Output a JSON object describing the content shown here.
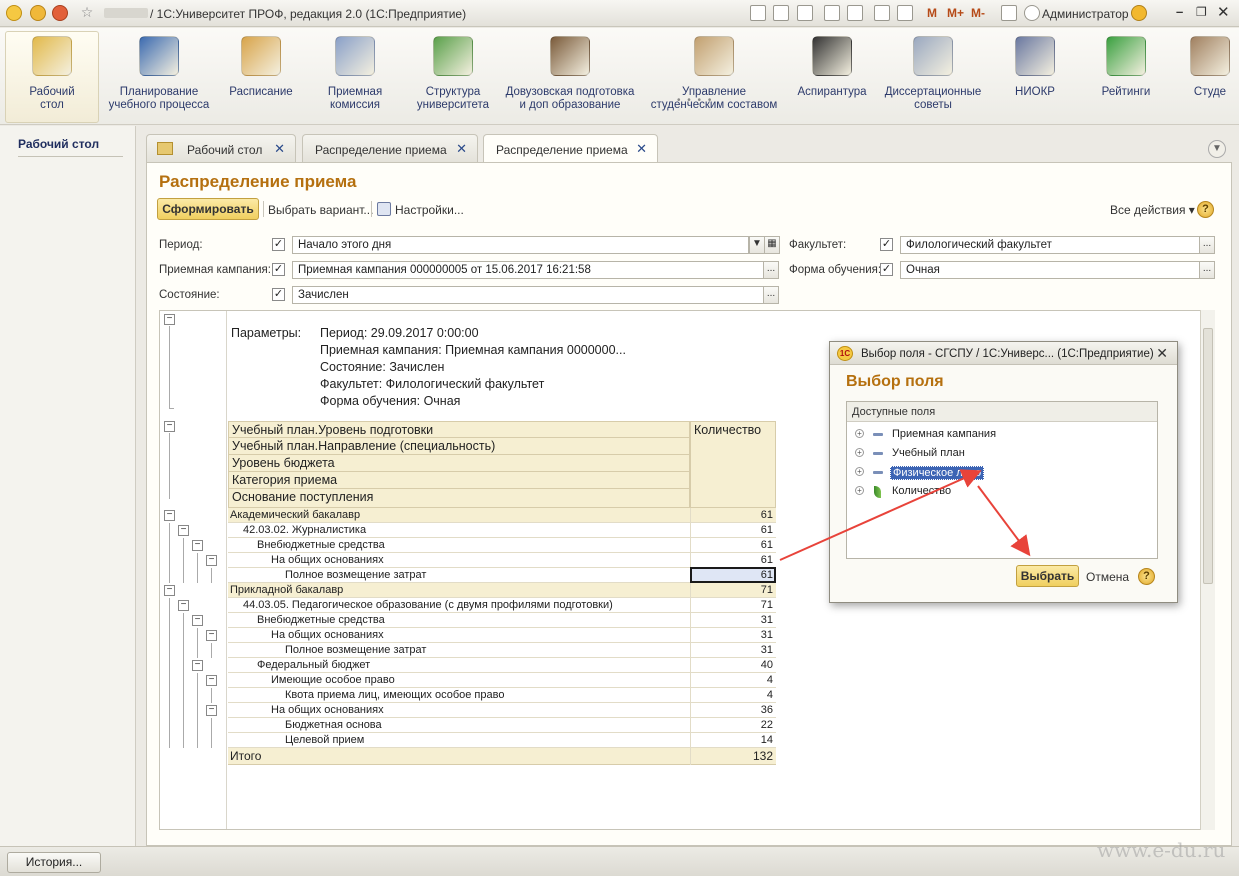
{
  "titlebar": {
    "title": "/ 1С:Университет ПРОФ, редакция 2.0  (1С:Предприятие)",
    "mem_m": "M",
    "mem_mplus": "M+",
    "mem_mminus": "M-",
    "user": "Администратор"
  },
  "sections": [
    {
      "label": "Рабочий\nстол",
      "icon": "desk-lamp-icon"
    },
    {
      "label": "Планирование\nучебного процесса",
      "icon": "book-icon"
    },
    {
      "label": "Расписание",
      "icon": "calendar-icon"
    },
    {
      "label": "Приемная\nкомиссия",
      "icon": "form-icon"
    },
    {
      "label": "Структура\nуниверситета",
      "icon": "structure-icon"
    },
    {
      "label": "Довузовская подготовка\nи доп образование",
      "icon": "teacher-icon"
    },
    {
      "label": "Управление\nстуденческим составом",
      "icon": "id-card-icon"
    },
    {
      "label": "Аспирантура",
      "icon": "graduation-cap-icon"
    },
    {
      "label": "Диссертационные\nсоветы",
      "icon": "document-icon"
    },
    {
      "label": "НИОКР",
      "icon": "microscope-icon"
    },
    {
      "label": "Рейтинги",
      "icon": "pie-chart-icon"
    },
    {
      "label": "Студе",
      "icon": "student-icon"
    }
  ],
  "leftpanel": {
    "item": "Рабочий стол"
  },
  "tabs": [
    {
      "label": "Рабочий стол"
    },
    {
      "label": "Распределение приема"
    },
    {
      "label": "Распределение приема"
    }
  ],
  "form": {
    "title": "Распределение приема",
    "generate": "Сформировать",
    "choose_variant": "Выбрать вариант...",
    "settings": "Настройки...",
    "all_actions": "Все действия ▾",
    "help": "?"
  },
  "filters": {
    "period_label": "Период:",
    "period_value": "Начало этого дня",
    "campaign_label": "Приемная кампания:",
    "campaign_value": "Приемная кампания 000000005 от 15.06.2017 16:21:58",
    "state_label": "Состояние:",
    "state_value": "Зачислен",
    "faculty_label": "Факультет:",
    "faculty_value": "Филологический факультет",
    "form_label": "Форма обучения:",
    "form_value": "Очная"
  },
  "report": {
    "params_label": "Параметры:",
    "params": [
      "Период: 29.09.2017 0:00:00",
      "Приемная кампания: Приемная кампания 0000000...",
      "Состояние: Зачислен",
      "Факультет: Филологический факультет",
      "Форма обучения: Очная"
    ],
    "headers": [
      "Учебный план.Уровень подготовки",
      "Учебный план.Направление (специальность)",
      "Уровень бюджета",
      "Категория приема",
      "Основание поступления"
    ],
    "qty_header": "Количество",
    "rows": [
      {
        "name": "Академический бакалавр",
        "value": "61",
        "level": 0
      },
      {
        "name": "42.03.02. Журналистика",
        "value": "61",
        "level": 1
      },
      {
        "name": "Внебюджетные средства",
        "value": "61",
        "level": 2
      },
      {
        "name": "На общих основаниях",
        "value": "61",
        "level": 3
      },
      {
        "name": "Полное возмещение затрат",
        "value": "61",
        "level": 4
      },
      {
        "name": "Прикладной бакалавр",
        "value": "71",
        "level": 0
      },
      {
        "name": "44.03.05. Педагогическое образование (с двумя профилями подготовки)",
        "value": "71",
        "level": 1
      },
      {
        "name": "Внебюджетные средства",
        "value": "31",
        "level": 2
      },
      {
        "name": "На общих основаниях",
        "value": "31",
        "level": 3
      },
      {
        "name": "Полное возмещение затрат",
        "value": "31",
        "level": 4
      },
      {
        "name": "Федеральный бюджет",
        "value": "40",
        "level": 2
      },
      {
        "name": "Имеющие особое право",
        "value": "4",
        "level": 3
      },
      {
        "name": "Квота приема лиц, имеющих особое право",
        "value": "4",
        "level": 4
      },
      {
        "name": "На общих основаниях",
        "value": "36",
        "level": 3
      },
      {
        "name": "Бюджетная основа",
        "value": "22",
        "level": 4
      },
      {
        "name": "Целевой прием",
        "value": "14",
        "level": 4
      }
    ],
    "total_label": "Итого",
    "total_value": "132"
  },
  "dialog": {
    "title": "Выбор поля - СГСПУ / 1С:Универс...  (1С:Предприятие)",
    "heading": "Выбор поля",
    "list_header": "Доступные поля",
    "items": [
      "Приемная кампания",
      "Учебный план",
      "Физическое лицо",
      "Количество"
    ],
    "select": "Выбрать",
    "cancel": "Отмена"
  },
  "bottom": {
    "history": "История..."
  },
  "watermark": "www.e-du.ru",
  "colors": {
    "accent": "#b5700f",
    "arrow": "#e8433a",
    "selected": "#3c64b4"
  }
}
